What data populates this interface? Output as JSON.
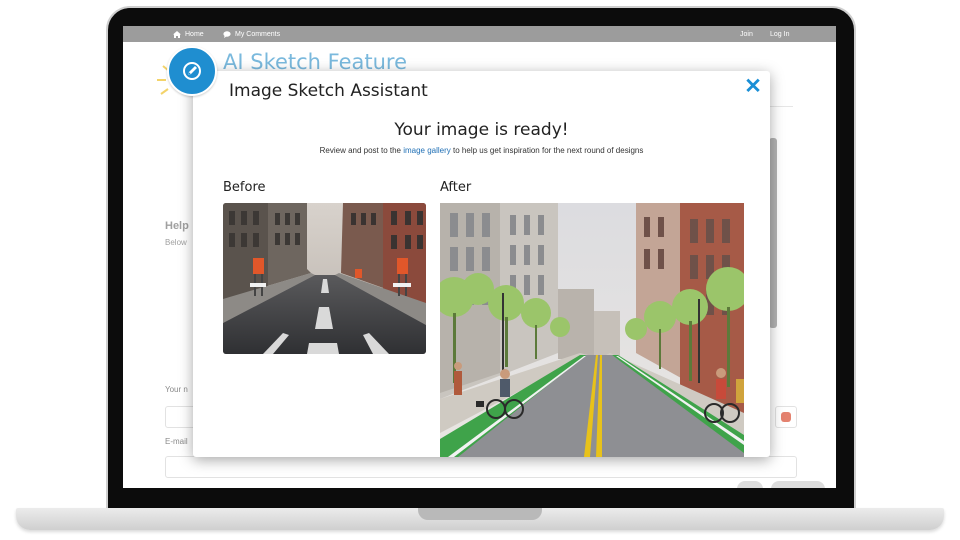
{
  "site": {
    "nav": {
      "home_label": "Home",
      "comments_label": "My Comments",
      "join_label": "Join",
      "login_label": "Log In"
    },
    "page_title": "AI Sketch Feature",
    "section_heading": "Help",
    "section_sub": "Below",
    "name_label": "Your n",
    "email_label": "E-mail"
  },
  "modal": {
    "title": "Image Sketch Assistant",
    "close_glyph": "✕",
    "heading": "Your image is ready!",
    "sub_before": "Review and post to the ",
    "sub_link": "image gallery",
    "sub_after": " to help us get inspiration for the next round of designs",
    "before_label": "Before",
    "after_label": "After"
  },
  "icons": {
    "home": "home-icon",
    "comments": "speech-bubble-icon",
    "badge": "sketch-pencil-icon",
    "close": "close-icon"
  },
  "colors": {
    "nav_bar": "#9c9c9c",
    "accent_blue": "#1f8ed0",
    "title_blue": "#7ab9dd",
    "link_blue": "#1f6fb5",
    "bike_lane_green": "#3fa34a",
    "road_line_yellow": "#e8c21a"
  }
}
